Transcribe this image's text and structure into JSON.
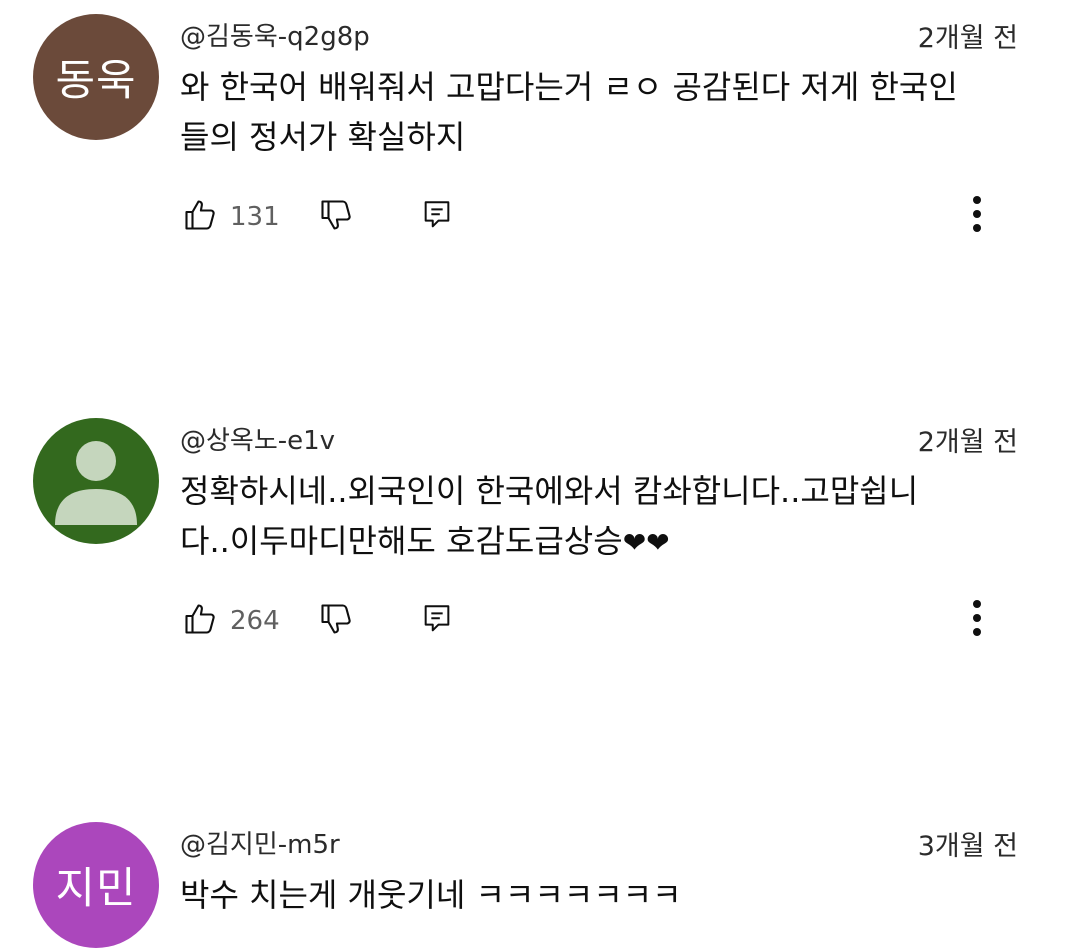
{
  "comments": [
    {
      "author": "@김동욱-q2g8p",
      "time": "2개월 전",
      "text_line1": "와 한국어 배워줘서 고맙다는거 ㄹㅇ 공감된다 저게 한국인",
      "text_line2": "들의 정서가 확실하지",
      "avatar_text": "동욱",
      "avatar_color": "#6b4a3a",
      "likes": "131"
    },
    {
      "author": "@상옥노-e1v",
      "time": "2개월 전",
      "text_line1": "정확하시네..외국인이 한국에와서 캄솨합니다..고맙쉽니",
      "text_line2": "다..이두마디만해도 호감도급상승",
      "text_emoji": "❤❤",
      "avatar_text": "",
      "avatar_color": "#33691e",
      "likes": "264"
    },
    {
      "author": "@김지민-m5r",
      "time": "3개월 전",
      "text_line1": "박수 치는게 개웃기네 ㅋㅋㅋㅋㅋㅋㅋ",
      "avatar_text": "지민",
      "avatar_color": "#ab47bc"
    }
  ],
  "icons": {
    "like": "thumbs-up-icon",
    "dislike": "thumbs-down-icon",
    "reply": "reply-icon",
    "more": "more-vert-icon",
    "default_avatar": "person-icon"
  }
}
